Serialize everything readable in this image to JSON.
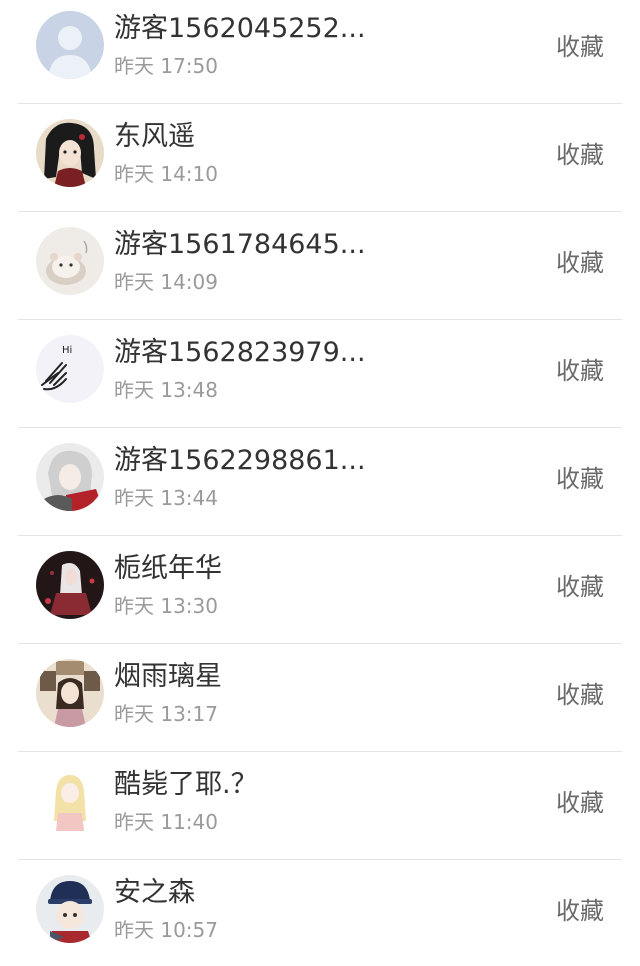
{
  "items": [
    {
      "name": "游客1562045252...",
      "time": "昨天 17:50",
      "action": "收藏",
      "avatar": "default-user-avatar"
    },
    {
      "name": "东风遥",
      "time": "昨天 14:10",
      "action": "收藏",
      "avatar": "anime-portrait-avatar"
    },
    {
      "name": "游客1561784645...",
      "time": "昨天 14:09",
      "action": "收藏",
      "avatar": "hamster-avatar"
    },
    {
      "name": "游客1562823979...",
      "time": "昨天 13:48",
      "action": "收藏",
      "avatar": "hand-hi-avatar"
    },
    {
      "name": "游客1562298861...",
      "time": "昨天 13:44",
      "action": "收藏",
      "avatar": "anime-white-hair-avatar"
    },
    {
      "name": "栀纸年华",
      "time": "昨天 13:30",
      "action": "收藏",
      "avatar": "anime-dark-avatar"
    },
    {
      "name": "烟雨璃星",
      "time": "昨天 13:17",
      "action": "收藏",
      "avatar": "anime-girl-frames-avatar"
    },
    {
      "name": "酷毙了耶.？",
      "time": "昨天 11:40",
      "action": "收藏",
      "avatar": "blonde-girl-avatar"
    },
    {
      "name": "安之森",
      "time": "昨天 10:57",
      "action": "收藏",
      "avatar": "boy-cap-avatar"
    }
  ]
}
